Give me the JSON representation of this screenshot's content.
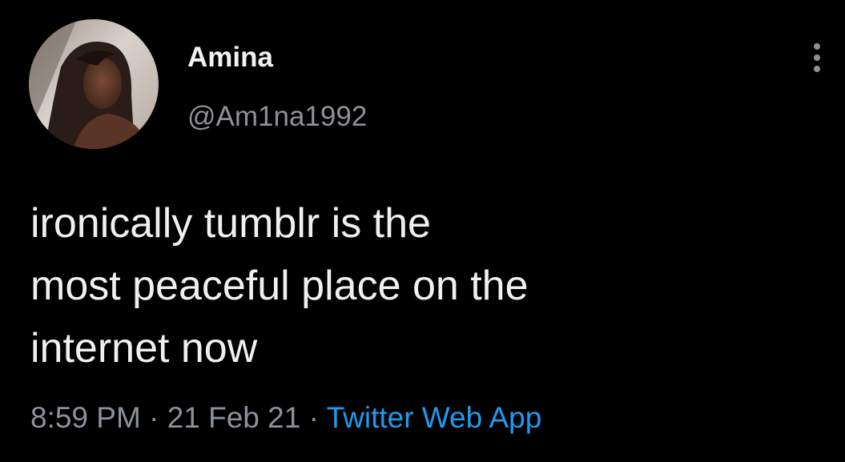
{
  "user": {
    "display_name": "Amina",
    "handle": "@Am1na1992",
    "avatar_icon": "profile-photo"
  },
  "menu": {
    "icon": "more-vertical-icon"
  },
  "tweet": {
    "lines": [
      "ironically tumblr is the",
      "most peaceful place on the",
      "internet now"
    ],
    "time": "8:59 PM",
    "separator": "·",
    "date": "21 Feb 21",
    "source": "Twitter Web App"
  },
  "colors": {
    "background": "#000000",
    "text": "#f0f0f0",
    "secondary": "#8b9299",
    "link": "#1d9bf0"
  }
}
